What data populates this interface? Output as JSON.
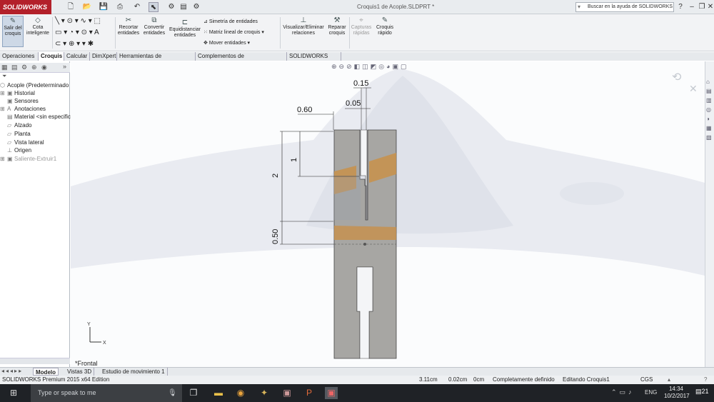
{
  "app": {
    "logo": "SOLIDWORKS",
    "doc_title": "Croquis1 de Acople.SLDPRT *"
  },
  "search": {
    "placeholder": "Buscar en la ayuda de SOLIDWORKS"
  },
  "ribbon": {
    "exit_sketch": "Salir del croquis",
    "smart_dim": "Cota inteligente",
    "trim": "Recortar entidades",
    "convert": "Convertir entidades",
    "offset": "Equidistanciar entidades",
    "mirror": "Simetría de entidades",
    "linear_pattern": "Matriz lineal de croquis",
    "move": "Mover entidades",
    "relations": "Visualizar/Eliminar relaciones",
    "repair": "Reparar croquis",
    "quick_snaps": "Capturas rápidas",
    "rapid_sketch": "Croquis rápido"
  },
  "tabs": [
    "Operaciones",
    "Croquis",
    "Calcular",
    "DimXpert",
    "Herramientas de renderizado",
    "Complementos de SOLIDWORKS",
    "SOLIDWORKS MBD"
  ],
  "active_tab": "Croquis",
  "tree": {
    "root": "Acople  (Predeterminado",
    "items": [
      "Historial",
      "Sensores",
      "Anotaciones",
      "Material <sin especificar>",
      "Alzado",
      "Planta",
      "Vista lateral",
      "Origen",
      "Saliente-Extruir1"
    ]
  },
  "dims": {
    "d015": "0.15",
    "d005": "0.05",
    "d060": "0.60",
    "d1": "1",
    "d2": "2",
    "d050": "0.50"
  },
  "view": {
    "label": "*Frontal",
    "axis_y": "Y",
    "axis_x": "X"
  },
  "bottom_tabs": [
    "Modelo",
    "Vistas 3D",
    "Estudio de movimiento 1"
  ],
  "status": {
    "edition": "SOLIDWORKS Premium 2015 x64 Edition",
    "x": "3.11cm",
    "y": "0.02cm",
    "z": "0cm",
    "state": "Completamente definido",
    "editing": "Editando Croquis1",
    "units": "CGS"
  },
  "taskbar": {
    "search": "Type or speak to me",
    "lang": "ENG",
    "time": "14:34",
    "date": "10/2/2017",
    "notif": "21"
  },
  "colors": {
    "brand": "#b3202a",
    "part": "#a7a6a3",
    "highlight": "#c8904a"
  }
}
